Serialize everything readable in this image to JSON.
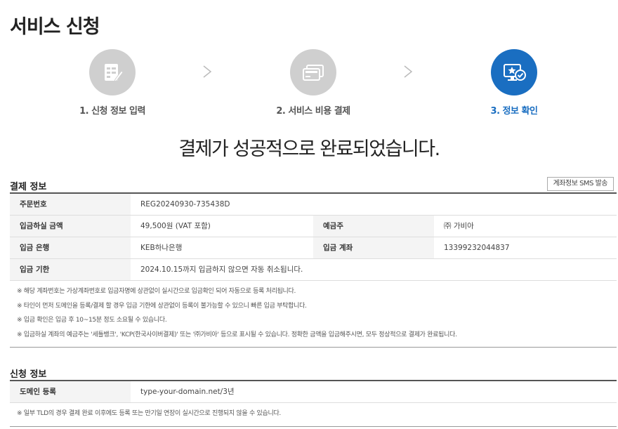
{
  "page_title": "서비스 신청",
  "steps": [
    {
      "label": "1. 신청 정보 입력",
      "icon": "form-edit-icon",
      "active": false
    },
    {
      "label": "2. 서비스 비용 결제",
      "icon": "payment-cards-icon",
      "active": false
    },
    {
      "label": "3. 정보 확인",
      "icon": "monitor-check-icon",
      "active": true
    }
  ],
  "success_message": "결제가 성공적으로 완료되었습니다.",
  "payment_section": {
    "title": "결제 정보",
    "sms_button": "계좌정보 SMS 발송",
    "order_no_label": "주문번호",
    "order_no": "REG20240930-735438D",
    "amount_label": "입금하실 금액",
    "amount": "49,500원 (VAT 포함)",
    "depositor_label": "예금주",
    "depositor": "㈜ 가비아",
    "bank_label": "입금 은행",
    "bank": "KEB하나은행",
    "account_label": "입금 계좌",
    "account": "13399232044837",
    "deadline_label": "입금 기한",
    "deadline": "2024.10.15까지 입금하지 않으면 자동 취소됩니다.",
    "notes": [
      "※ 해당 계좌번호는 가상계좌번호로 입금자명에 상관없이 실시간으로 입금확인 되어 자동으로 등록 처리됩니다.",
      "※ 타인이 먼저 도메인을 등록/결제 할 경우 입금 기한에 상관없이 등록이 불가능할 수 있으니 빠른 입금 부탁합니다.",
      "※ 입금 확인은 입금 후 10~15분 정도 소요될 수 있습니다.",
      "※ 입금하실 계좌의 예금주는 '세틀뱅크', 'KCP(한국사이버결제)' 또는 '㈜가비아' 등으로 표시될 수 있습니다. 정확한 금액을 입금해주시면, 모두 정상적으로 결제가 완료됩니다."
    ]
  },
  "application_section": {
    "title": "신청 정보",
    "domain_label": "도메인 등록",
    "domain_value": "type-your-domain.net/3년",
    "notes": [
      "※ 일부 TLD의 경우 결제 완료 이후에도 등록 또는 만기일 연장이 실시간으로 진행되지 않을 수 있습니다."
    ]
  },
  "colors": {
    "accent": "#1a6ec1",
    "inactive_step": "#cfcfcf"
  }
}
